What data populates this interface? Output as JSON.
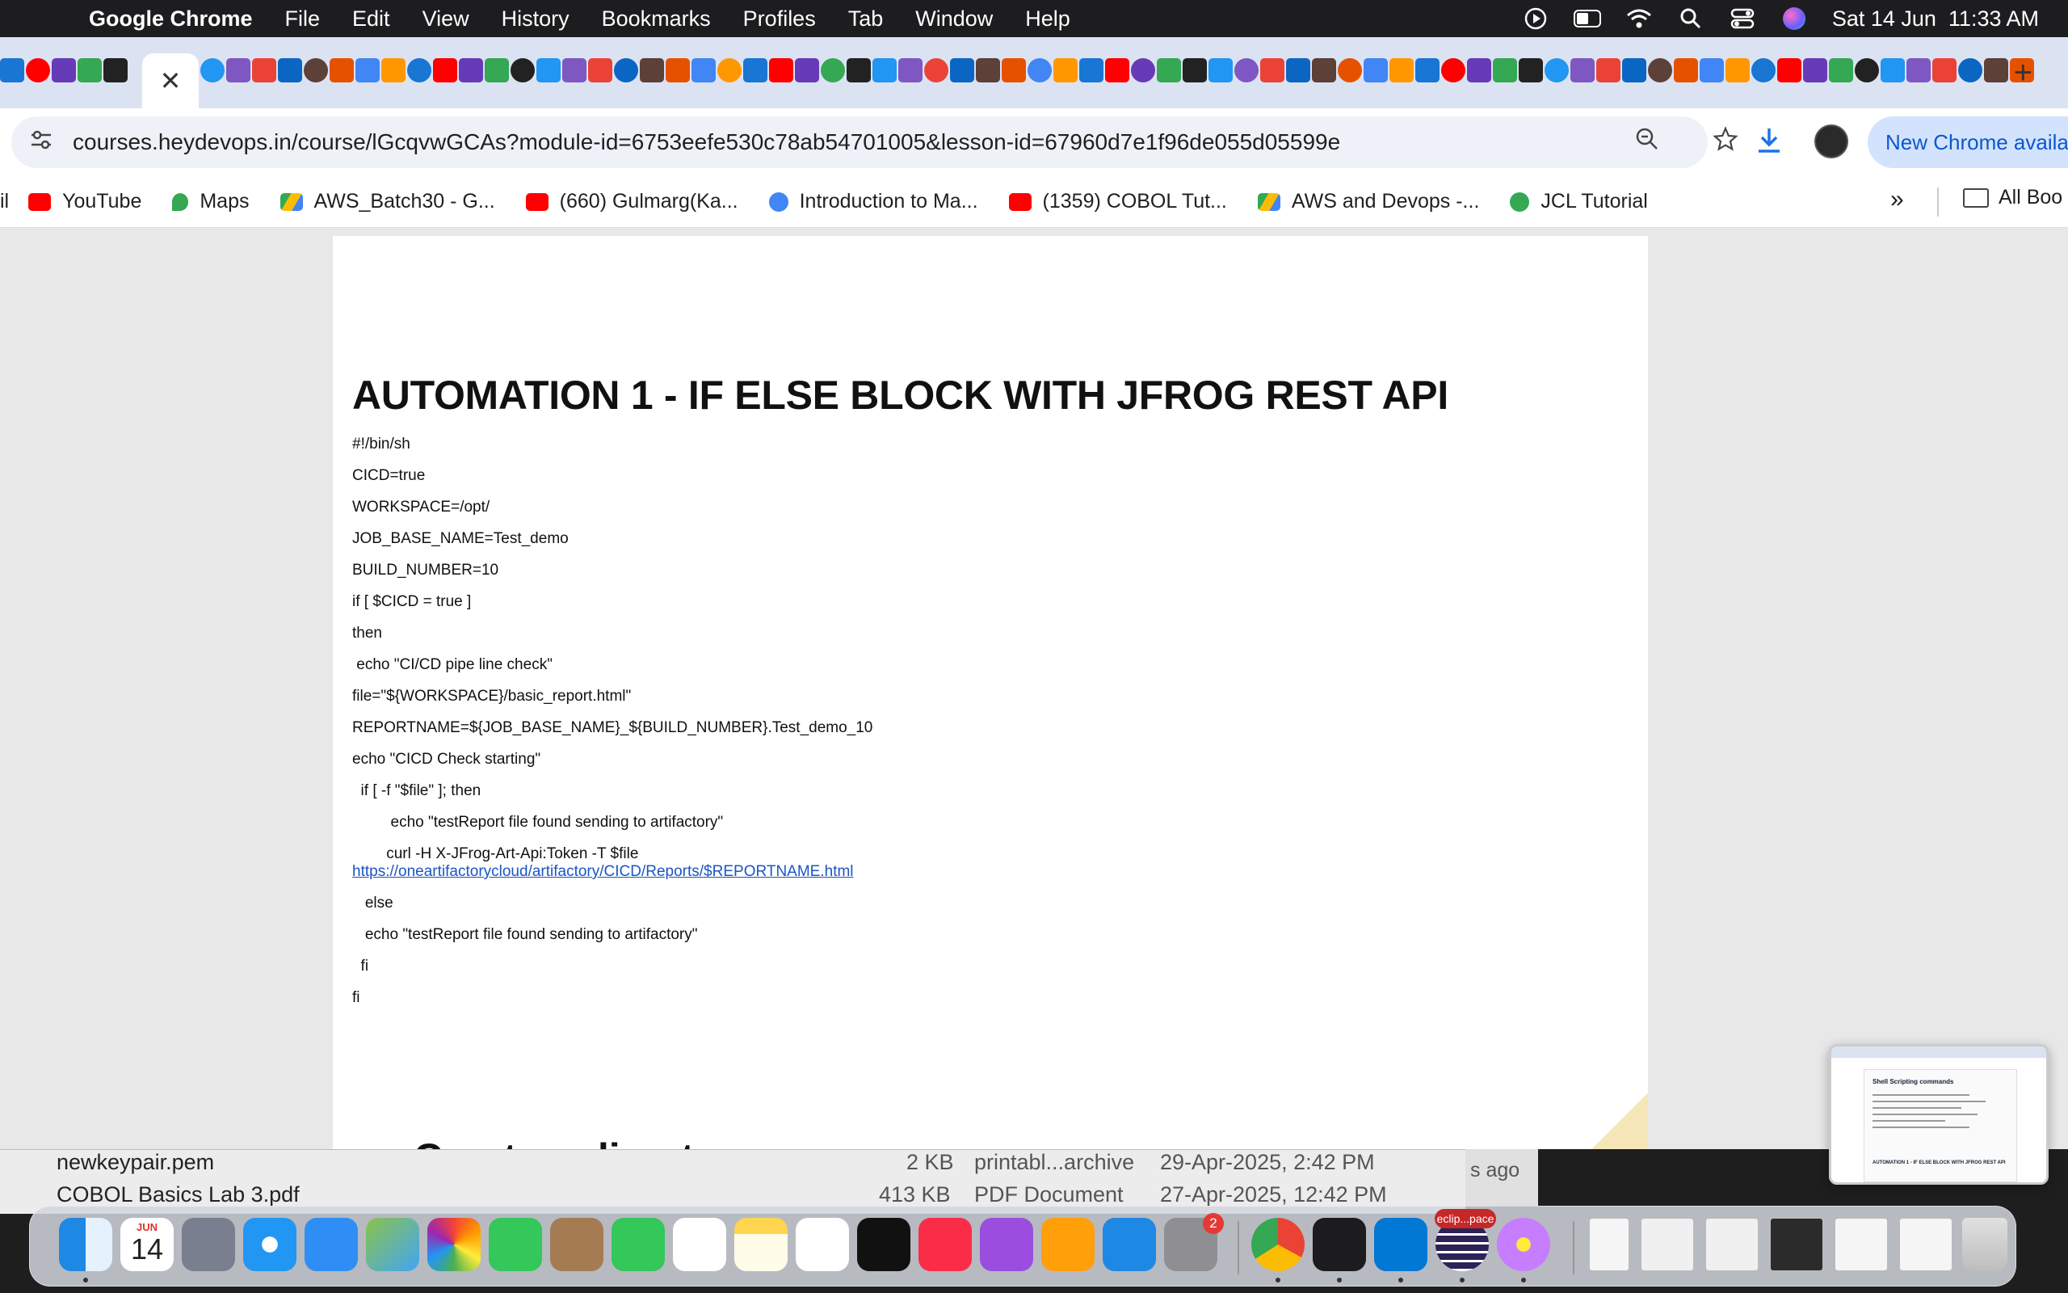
{
  "menubar": {
    "app_name": "Google Chrome",
    "menus": [
      "File",
      "Edit",
      "View",
      "History",
      "Bookmarks",
      "Profiles",
      "Tab",
      "Window",
      "Help"
    ],
    "datetime": "Sat 14 Jun  11:33 AM"
  },
  "tabs": {
    "active_close_glyph": "✕",
    "new_tab_glyph": "+"
  },
  "toolbar": {
    "url": "courses.heydevops.in/course/lGcqvwGCAs?module-id=6753eefe530c78ab54701005&lesson-id=67960d7e1f96de055d05599e",
    "update_label": "New Chrome available"
  },
  "bookmarks": {
    "items": [
      {
        "label": "il",
        "icon_color": "#ffffff"
      },
      {
        "label": "YouTube",
        "icon_color": "#ff0000"
      },
      {
        "label": "Maps",
        "icon_color": "#34a853"
      },
      {
        "label": "AWS_Batch30 - G...",
        "icon_color": "#fbbc04"
      },
      {
        "label": "(660) Gulmarg(Ka...",
        "icon_color": "#ff0000"
      },
      {
        "label": "Introduction to Ma...",
        "icon_color": "#4285f4"
      },
      {
        "label": "(1359) COBOL Tut...",
        "icon_color": "#ff0000"
      },
      {
        "label": "AWS and Devops -...",
        "icon_color": "#fbbc04"
      },
      {
        "label": "JCL Tutorial",
        "icon_color": "#34a853"
      }
    ],
    "more_glyph": "»",
    "folder_label": "All Boo"
  },
  "document": {
    "title": "AUTOMATION 1 - IF ELSE BLOCK WITH JFROG REST API",
    "code_lines": [
      "#!/bin/sh",
      "CICD=true",
      "WORKSPACE=/opt/",
      "JOB_BASE_NAME=Test_demo",
      "BUILD_NUMBER=10",
      "if [ $CICD = true ]",
      "then",
      " echo \"CI/CD pipe line check\"",
      "file=\"${WORKSPACE}/basic_report.html\"",
      "REPORTNAME=${JOB_BASE_NAME}_${BUILD_NUMBER}.Test_demo_10",
      "echo \"CICD Check starting\"",
      "  if [ -f \"$file\" ]; then",
      "         echo \"testReport file found sending to artifactory\"",
      "        curl -H X-JFrog-Art-Api:Token -T $file"
    ],
    "link": "https://oneartifactorycloud/artifactory/CICD/Reports/$REPORTNAME.html",
    "code_lines_after": [
      "   else",
      "   echo \"testReport file found sending to artifactory\"",
      "  fi",
      "fi"
    ],
    "next_heading": "Create a directory"
  },
  "filelist": {
    "rows": [
      {
        "name": "newkeypair.pem",
        "size": "2 KB",
        "kind": "printabl...archive",
        "date": "29-Apr-2025, 2:42 PM"
      },
      {
        "name": "COBOL Basics Lab 3.pdf",
        "size": "413 KB",
        "kind": "PDF Document",
        "date": "27-Apr-2025, 12:42 PM"
      }
    ],
    "aside": "s ago"
  },
  "thumbnail": {
    "heading": "Shell Scripting commands",
    "footer": "AUTOMATION 1 - IF ELSE BLOCK WITH JFROG REST API"
  },
  "dock": {
    "calendar_month": "JUN",
    "calendar_day": "14",
    "settings_badge": "2",
    "eclipse_label": "eclip...pace"
  }
}
